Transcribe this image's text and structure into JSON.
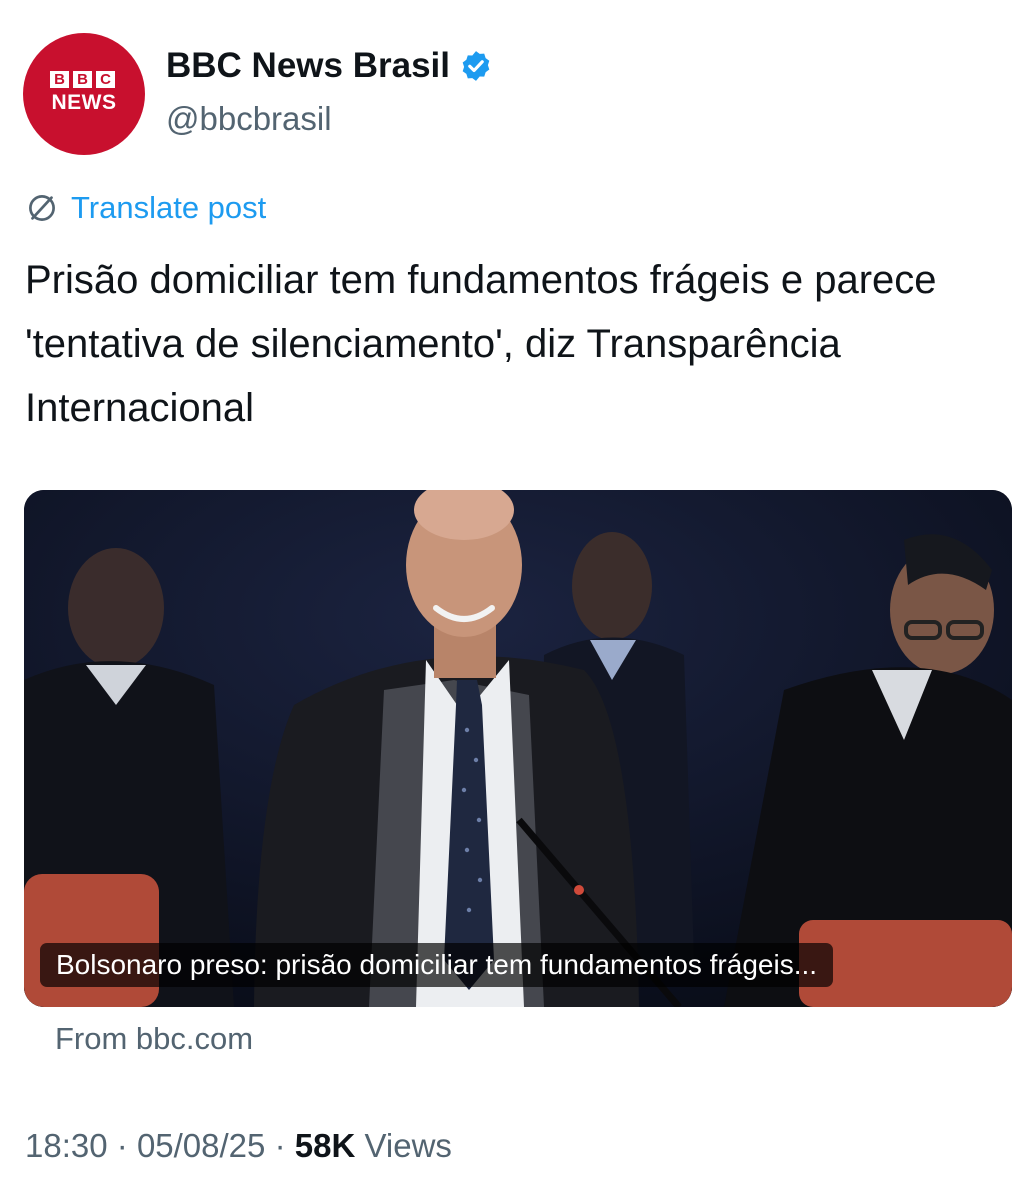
{
  "account": {
    "display_name": "BBC News Brasil",
    "handle": "@bbcbrasil",
    "avatar_logo_top": [
      "B",
      "B",
      "C"
    ],
    "avatar_logo_bottom": "NEWS",
    "brand_color": "#c8102e",
    "verified_color": "#1d9bf0",
    "verified_icon": "verified-badge-icon"
  },
  "translate": {
    "label": "Translate post",
    "icon": "globe-icon",
    "color": "#1d9bf0"
  },
  "post": {
    "text": "Prisão domiciliar tem fundamentos frágeis e parece 'tentativa de silenciamento', diz Transparência Internacional"
  },
  "link_card": {
    "caption": "Bolsonaro preso: prisão domiciliar tem fundamentos frágeis...",
    "source": "From bbc.com"
  },
  "meta": {
    "time": "18:30",
    "separator": "·",
    "date": "05/08/25",
    "views_count": "58K",
    "views_label": "Views"
  }
}
